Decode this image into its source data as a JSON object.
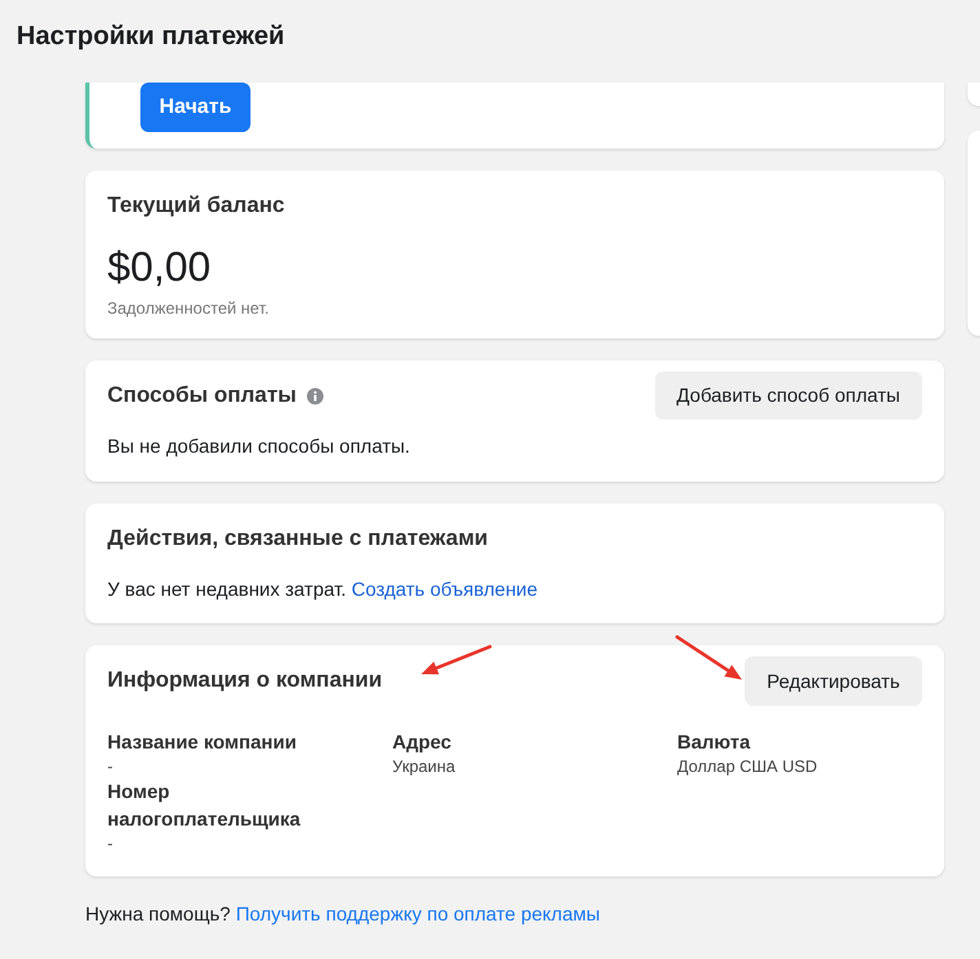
{
  "page": {
    "title": "Настройки платежей"
  },
  "promo_card": {
    "button": "Начать"
  },
  "balance_card": {
    "title": "Текущий баланс",
    "amount": "$0,00",
    "note": "Задолженностей нет."
  },
  "payment_methods_card": {
    "title": "Способы оплаты",
    "button": "Добавить способ оплаты",
    "message": "Вы не добавили способы оплаты."
  },
  "payment_activity_card": {
    "title": "Действия, связанные с платежами",
    "message": "У вас нет недавних затрат.",
    "link": "Создать объявление"
  },
  "company_info_card": {
    "title": "Информация о компании",
    "button": "Редактировать",
    "fields": [
      {
        "label": "Название компании",
        "value": "-"
      },
      {
        "label": "Адрес",
        "value": "Украина"
      },
      {
        "label": "Валюта",
        "value": "Доллар США USD"
      },
      {
        "label": "Номер налогоплательщика",
        "value": "-"
      }
    ]
  },
  "help": {
    "text": "Нужна помощь?",
    "link": "Получить поддержку по оплате рекламы"
  }
}
